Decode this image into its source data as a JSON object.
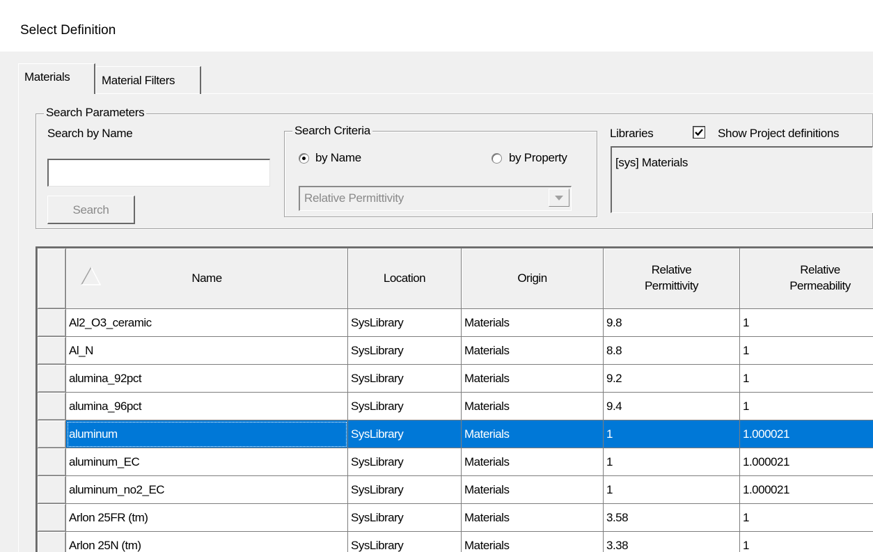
{
  "window": {
    "title": "Select Definition"
  },
  "tabs": [
    {
      "label": "Materials",
      "active": true
    },
    {
      "label": "Material Filters",
      "active": false
    }
  ],
  "search_parameters": {
    "legend": "Search Parameters",
    "search_by_name_label": "Search by Name",
    "search_input_value": "",
    "search_button_label": "Search"
  },
  "search_criteria": {
    "legend": "Search Criteria",
    "by_name_label": "by Name",
    "by_property_label": "by Property",
    "selected": "by Name",
    "property_select_value": "Relative Permittivity"
  },
  "libraries": {
    "label": "Libraries",
    "show_project_definitions_label": "Show Project definitions",
    "show_project_definitions_checked": true,
    "items": [
      "[sys] Materials"
    ]
  },
  "table": {
    "columns": [
      "Name",
      "Location",
      "Origin",
      "Relative Permittivity",
      "Relative Permeability"
    ],
    "column_lines": [
      [
        "Name"
      ],
      [
        "Location"
      ],
      [
        "Origin"
      ],
      [
        "Relative",
        "Permittivity"
      ],
      [
        "Relative",
        "Permeability"
      ]
    ],
    "selected_row": 4,
    "rows": [
      [
        "Al2_O3_ceramic",
        "SysLibrary",
        "Materials",
        "9.8",
        "1"
      ],
      [
        "Al_N",
        "SysLibrary",
        "Materials",
        "8.8",
        "1"
      ],
      [
        "alumina_92pct",
        "SysLibrary",
        "Materials",
        "9.2",
        "1"
      ],
      [
        "alumina_96pct",
        "SysLibrary",
        "Materials",
        "9.4",
        "1"
      ],
      [
        "aluminum",
        "SysLibrary",
        "Materials",
        "1",
        "1.000021"
      ],
      [
        "aluminum_EC",
        "SysLibrary",
        "Materials",
        "1",
        "1.000021"
      ],
      [
        "aluminum_no2_EC",
        "SysLibrary",
        "Materials",
        "1",
        "1.000021"
      ],
      [
        "Arlon 25FR (tm)",
        "SysLibrary",
        "Materials",
        "3.58",
        "1"
      ],
      [
        "Arlon 25N (tm)",
        "SysLibrary",
        "Materials",
        "3.38",
        "1"
      ]
    ]
  },
  "colors": {
    "selection": "#0078d7",
    "dialog_bg": "#f0f0f0",
    "disabled_text": "#8a8a8a"
  },
  "icons": {
    "sort": "sort-ascending-icon",
    "dropdown": "chevron-down-icon",
    "checkbox": "checkmark-icon"
  }
}
